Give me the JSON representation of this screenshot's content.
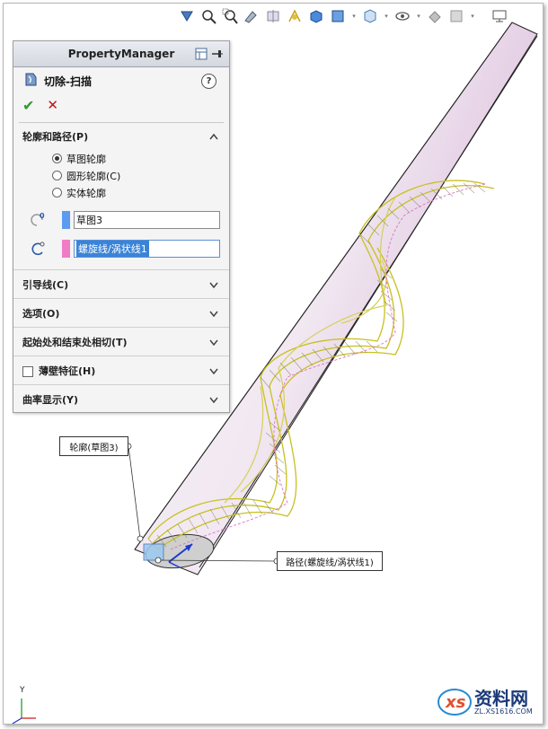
{
  "property_manager": {
    "header_title": "PropertyManager",
    "feature_title": "切除-扫描",
    "help": "?",
    "ok": "✔",
    "cancel": "✕",
    "profile_path_group": {
      "title": "轮廓和路径(P)",
      "radio_options": [
        {
          "label": "草图轮廓",
          "selected": true
        },
        {
          "label": "圆形轮廓(C)",
          "selected": false
        },
        {
          "label": "实体轮廓",
          "selected": false
        }
      ],
      "profile_value": "草图3",
      "profile_color": "#5b9bf0",
      "path_value": "螺旋线/涡状线1",
      "path_color": "#f07cc6"
    },
    "collapsed_groups": [
      {
        "title": "引导线(C)"
      },
      {
        "title": "选项(O)"
      },
      {
        "title": "起始处和结束处相切(T)"
      },
      {
        "title": "薄壁特征(H)",
        "checkbox": true
      },
      {
        "title": "曲率显示(Y)"
      }
    ]
  },
  "callouts": {
    "profile_label": "轮廓(草图3)",
    "path_label": "路径(螺旋线/涡状线1)"
  },
  "watermark": {
    "name": "资料网",
    "url": "ZL.XS1616.COM"
  },
  "axis": {
    "label": "Y"
  },
  "toolbar_icons": [
    "view-orientation-icon",
    "zoom-to-fit-icon",
    "zoom-area-icon",
    "previous-view-icon",
    "section-view-icon",
    "dynamic-annotation-icon",
    "view-shaded-icon",
    "display-style-icon",
    "hide-show-icon",
    "edit-appearance-icon",
    "apply-scene-icon",
    "view-settings-icon",
    "monitor-icon"
  ]
}
